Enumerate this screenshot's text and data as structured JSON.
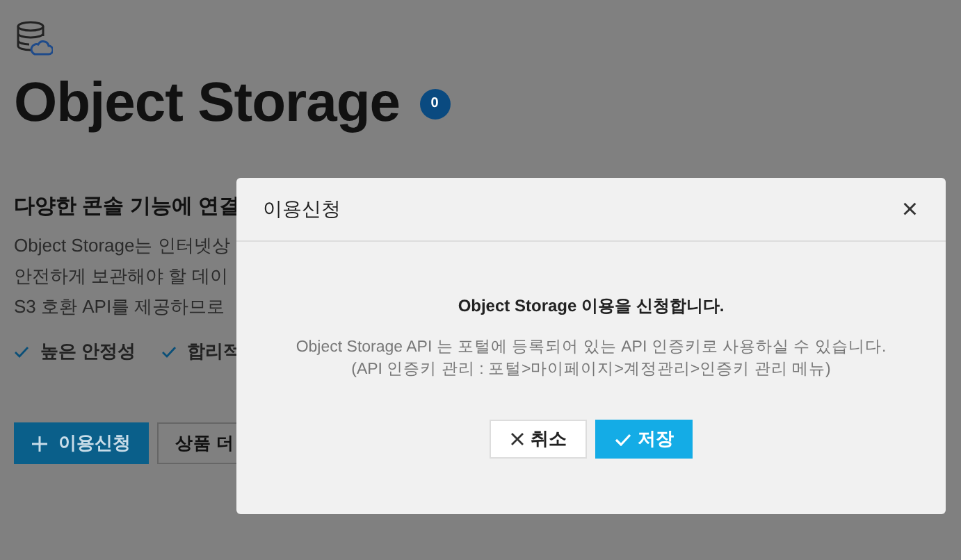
{
  "page": {
    "title": "Object Storage",
    "count": "0",
    "heading": "다양한 콘솔 기능에 연결",
    "description": [
      "Object Storage는 인터넷상",
      "안전하게 보관해야 할 데이",
      "S3 호환 API를 제공하므로"
    ],
    "features": [
      "높은 안정성",
      "합리적"
    ],
    "buttons": [
      {
        "kind": "primary",
        "label": "이용신청"
      },
      {
        "kind": "secondary",
        "label": "상품 더"
      }
    ]
  },
  "dialog": {
    "title": "이용신청",
    "close": "×",
    "message": "Object Storage 이용을 신청합니다.",
    "details": [
      "Object Storage API 는 포털에 등록되어 있는 API 인증키로 사용하실 수 있습니다.",
      "(API 인증키 관리 : 포털>마이페이지>계정관리>인증키 관리 메뉴)"
    ],
    "buttons": [
      {
        "kind": "cancel",
        "label": "취소"
      },
      {
        "kind": "save",
        "label": "저장"
      }
    ]
  }
}
